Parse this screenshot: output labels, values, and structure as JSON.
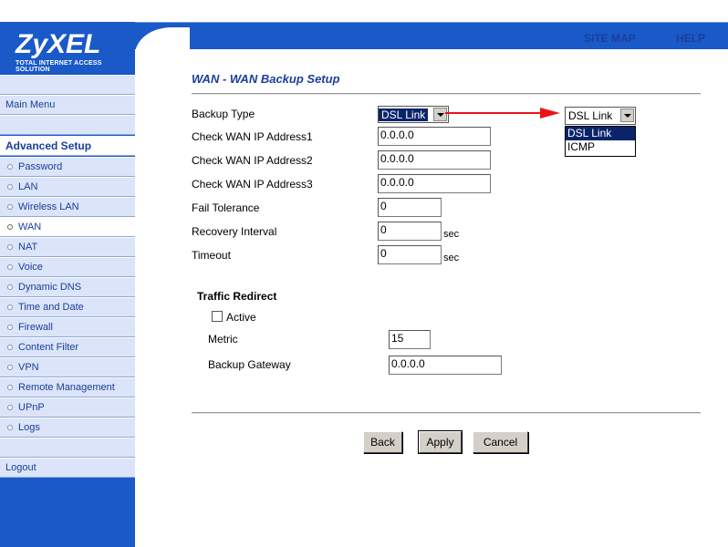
{
  "header": {
    "brand": "ZyXEL",
    "tagline": "TOTAL INTERNET ACCESS SOLUTION",
    "links": {
      "site_map": "SITE MAP",
      "help": "HELP"
    }
  },
  "sidebar": {
    "main_menu": "Main Menu",
    "section_title": "Advanced Setup",
    "items": [
      {
        "label": "Password"
      },
      {
        "label": "LAN"
      },
      {
        "label": "Wireless LAN"
      },
      {
        "label": "WAN"
      },
      {
        "label": "NAT"
      },
      {
        "label": "Voice"
      },
      {
        "label": "Dynamic DNS"
      },
      {
        "label": "Time and Date"
      },
      {
        "label": "Firewall"
      },
      {
        "label": "Content Filter"
      },
      {
        "label": "VPN"
      },
      {
        "label": "Remote Management"
      },
      {
        "label": "UPnP"
      },
      {
        "label": "Logs"
      }
    ],
    "active_item": "WAN",
    "logout": "Logout"
  },
  "main": {
    "title": "WAN - WAN Backup Setup",
    "form": {
      "backup_type_label": "Backup Type",
      "backup_type_value": "DSL Link",
      "check_wan1_label": "Check WAN IP Address1",
      "check_wan1_value": "0.0.0.0",
      "check_wan2_label": "Check WAN IP Address2",
      "check_wan2_value": "0.0.0.0",
      "check_wan3_label": "Check WAN IP Address3",
      "check_wan3_value": "0.0.0.0",
      "fail_tolerance_label": "Fail Tolerance",
      "fail_tolerance_value": "0",
      "recovery_interval_label": "Recovery Interval",
      "recovery_interval_value": "0",
      "recovery_interval_unit": "sec",
      "timeout_label": "Timeout",
      "timeout_value": "0",
      "timeout_unit": "sec"
    },
    "traffic_redirect": {
      "title": "Traffic Redirect",
      "active_label": "Active",
      "active_checked": false,
      "metric_label": "Metric",
      "metric_value": "15",
      "backup_gateway_label": "Backup Gateway",
      "backup_gateway_value": "0.0.0.0"
    },
    "buttons": {
      "back": "Back",
      "apply": "Apply",
      "cancel": "Cancel"
    }
  },
  "callout": {
    "select_value": "DSL Link",
    "options": [
      "DSL Link",
      "ICMP"
    ],
    "highlighted_option": "DSL Link",
    "arrow_color": "#e8141a"
  },
  "colors": {
    "brand_blue": "#1a59c8",
    "nav_bg": "#dbe4f8",
    "link_text": "#1a3f9a"
  }
}
